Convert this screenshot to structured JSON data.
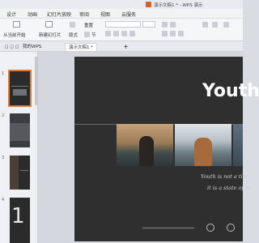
{
  "window": {
    "title": "演示文稿1 * - WPS 演示"
  },
  "menu": {
    "items": [
      "设计",
      "动画",
      "幻灯片放映",
      "审阅",
      "视图",
      "云服务"
    ]
  },
  "ribbon": {
    "current_layout": "版式",
    "start_from_current": "从当前开始",
    "new_slide": "新建幻灯片",
    "section": "节",
    "reset": "重置"
  },
  "tabs": {
    "wps_home": "我的WPS",
    "document": "演示文稿1 *",
    "add": "+"
  },
  "thumbnails": {
    "numbers": [
      "1",
      "2",
      "3",
      "4"
    ],
    "thumb4_text": "1"
  },
  "slide": {
    "title": "Youth",
    "quote_line1": "Youth is not a tim",
    "quote_line2": "it is a state of m"
  },
  "colors": {
    "accent": "#e07a3a",
    "slide_bg": "#2f2f2f",
    "brand": "#e05a2b"
  }
}
